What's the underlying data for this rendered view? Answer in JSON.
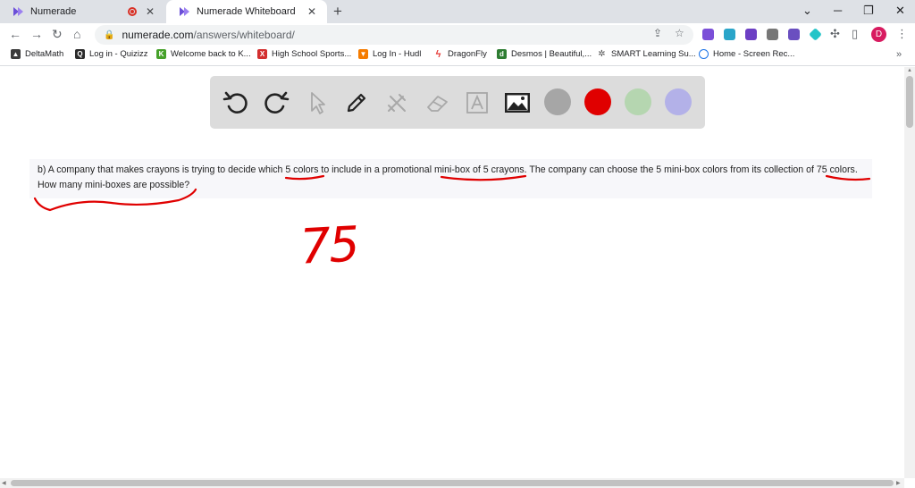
{
  "browser": {
    "tabs": [
      {
        "title": "Numerade",
        "active": false
      },
      {
        "title": "Numerade Whiteboard",
        "active": true
      }
    ],
    "new_tab": "+",
    "close_glyph": "✕",
    "url_host": "numerade.com",
    "url_path": "/answers/whiteboard/",
    "window_controls": [
      "⌄",
      "─",
      "❐",
      "✕"
    ],
    "avatar_letter": "D",
    "bookmarks": [
      {
        "label": "DeltaMath",
        "icon": "deltamath-icon",
        "color": "#3c3c3c"
      },
      {
        "label": "Log in - Quizizz",
        "icon": "quizizz-icon",
        "color": "#2b2b2b"
      },
      {
        "label": "Welcome back to K...",
        "icon": "kahoot-icon",
        "color": "#46a12a"
      },
      {
        "label": "High School Sports...",
        "icon": "highschool-sports-icon",
        "color": "#d32f2f"
      },
      {
        "label": "Log In - Hudl",
        "icon": "hudl-icon",
        "color": "#f57c00"
      },
      {
        "label": "DragonFly",
        "icon": "dragonfly-icon",
        "color": "#e53935"
      },
      {
        "label": "Desmos | Beautiful,...",
        "icon": "desmos-icon",
        "color": "#2e7d32"
      },
      {
        "label": "SMART Learning Su...",
        "icon": "smart-icon",
        "color": "#555555"
      },
      {
        "label": "Home - Screen Rec...",
        "icon": "screencastify-icon",
        "color": "#1a73e8"
      }
    ],
    "bookmarks_more": "»"
  },
  "whiteboard": {
    "tools": [
      "undo-icon",
      "redo-icon",
      "pointer-icon",
      "pen-icon",
      "tools-icon",
      "eraser-icon",
      "text-icon",
      "image-icon"
    ],
    "colors": [
      "#a6a6a6",
      "#e00000",
      "#b5d6b0",
      "#b3b1e8"
    ]
  },
  "question": {
    "text": "b) A company that makes crayons is trying to decide which 5 colors to include in a promotional mini-box of 5 crayons. The company can choose the 5 mini-box colors from its collection of 75 colors. How many mini-boxes are possible?"
  },
  "handwriting": {
    "number": "75",
    "ink_color": "#e00000"
  }
}
